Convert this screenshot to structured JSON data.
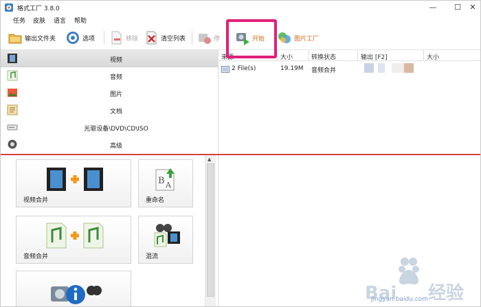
{
  "window": {
    "title": "格式工厂 3.8.0",
    "min": "—",
    "max": "☐",
    "close": "✕"
  },
  "menu": [
    "任务",
    "皮肤",
    "语言",
    "帮助"
  ],
  "toolbar": {
    "output_folder": "输出文件夹",
    "options": "选项",
    "remove": "移除",
    "clear_list": "清空列表",
    "stop": "停",
    "start": "开始",
    "picture_factory": "图片工厂"
  },
  "categories": [
    {
      "label": "视频",
      "icon": "film-icon"
    },
    {
      "label": "音频",
      "icon": "music-note-icon"
    },
    {
      "label": "图片",
      "icon": "picture-icon"
    },
    {
      "label": "文档",
      "icon": "document-icon"
    },
    {
      "label": "光驱设备\\DVD\\CD\\ISO",
      "icon": "disc-drive-icon"
    },
    {
      "label": "高级",
      "icon": "advanced-icon"
    }
  ],
  "filelist": {
    "columns": [
      "来源",
      "大小",
      "转换状态",
      "输出 [F2]",
      "大小"
    ],
    "rows": [
      {
        "source": "2 File(s)",
        "size": "19.19M",
        "status": "音频合并"
      }
    ]
  },
  "tools": {
    "video_merge": "视频合并",
    "rename": "重命名",
    "audio_merge": "音频合并",
    "mix": "混流"
  },
  "colors": {
    "highlight": "#e0207a",
    "accent_orange": "#d06a1a",
    "splitter": "#d94040"
  }
}
